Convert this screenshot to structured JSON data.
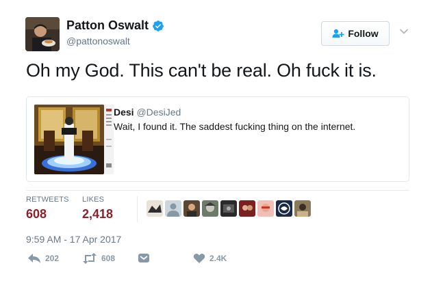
{
  "author": {
    "name": "Patton Oswalt",
    "handle": "@pattonoswalt",
    "verified": true
  },
  "follow": {
    "label": "Follow"
  },
  "tweet": {
    "text": "Oh my God. This can't be real. Oh fuck it is."
  },
  "quote": {
    "author_name": "Desi",
    "author_handle": "@DesiJed",
    "text": "Wait, I found it. The saddest fucking thing on the internet."
  },
  "stats": {
    "retweets_label": "RETWEETS",
    "retweets_value": "608",
    "likes_label": "LIKES",
    "likes_value": "2,418"
  },
  "timestamp": "9:59 AM - 17 Apr 2017",
  "actions": {
    "reply_count": "202",
    "retweet_count": "608",
    "like_count": "2.4K"
  },
  "colors": {
    "stat_value": "#8e1f2b",
    "verified": "#1da1f2",
    "muted": "#8899a6",
    "text": "#14171a"
  },
  "icons": {
    "verified": "verified-badge-icon",
    "follow": "add-person-icon",
    "menu": "chevron-down-icon",
    "reply": "reply-icon",
    "retweet": "retweet-icon",
    "dm": "direct-message-icon",
    "like": "heart-icon"
  }
}
